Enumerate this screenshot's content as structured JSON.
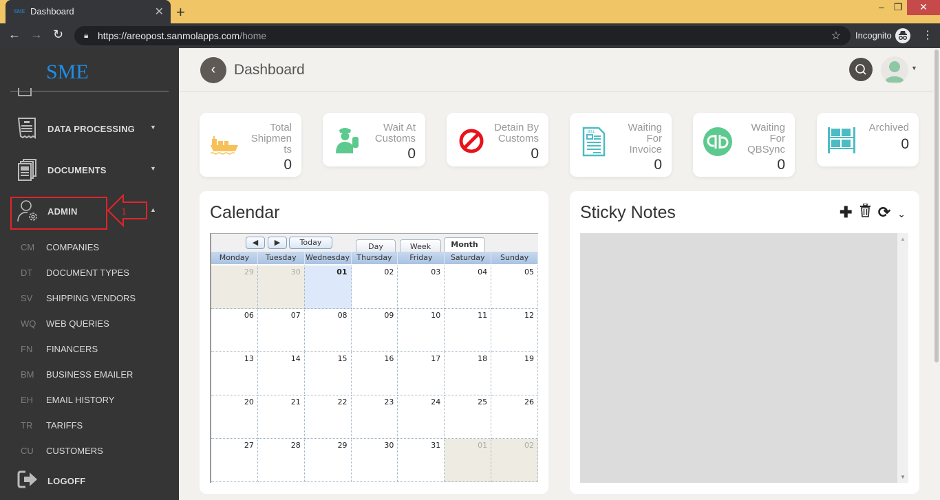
{
  "browser": {
    "tab_title": "Dashboard",
    "tab_favicon_text": "SME",
    "url_host": "https://areopost.sanmolapps.com",
    "url_path": "/home",
    "incognito_label": "Incognito"
  },
  "sidebar": {
    "logo": "SME",
    "items": [
      {
        "label": "DATA PROCESSING",
        "icon": "receipt-icon",
        "expanded": false
      },
      {
        "label": "DOCUMENTS",
        "icon": "documents-icon",
        "expanded": false
      },
      {
        "label": "ADMIN",
        "icon": "user-gear-icon",
        "expanded": true
      }
    ],
    "annotation_number": "1",
    "admin_subitems": [
      {
        "abbr": "CM",
        "label": "COMPANIES"
      },
      {
        "abbr": "DT",
        "label": "DOCUMENT TYPES"
      },
      {
        "abbr": "SV",
        "label": "SHIPPING VENDORS"
      },
      {
        "abbr": "WQ",
        "label": "WEB QUERIES"
      },
      {
        "abbr": "FN",
        "label": "FINANCERS"
      },
      {
        "abbr": "BM",
        "label": "BUSINESS EMAILER"
      },
      {
        "abbr": "EH",
        "label": "EMAIL HISTORY"
      },
      {
        "abbr": "TR",
        "label": "TARIFFS"
      },
      {
        "abbr": "CU",
        "label": "CUSTOMERS"
      }
    ],
    "logoff": "LOGOFF"
  },
  "header": {
    "title": "Dashboard"
  },
  "stats": [
    {
      "label_lines": [
        "Total",
        "Shipmen",
        "ts"
      ],
      "value": "0",
      "icon": "ship-icon",
      "color": "#f7c15a"
    },
    {
      "label_lines": [
        "Wait At",
        "Customs"
      ],
      "value": "0",
      "icon": "customs-officer-icon",
      "color": "#5cc98f"
    },
    {
      "label_lines": [
        "Detain By",
        "Customs"
      ],
      "value": "0",
      "icon": "prohibited-icon",
      "color": "#e8121a"
    },
    {
      "label_lines": [
        "Waiting",
        "For",
        "Invoice"
      ],
      "value": "0",
      "icon": "bill-icon",
      "color": "#4bbcc4"
    },
    {
      "label_lines": [
        "Waiting",
        "For",
        "QBSync"
      ],
      "value": "0",
      "icon": "quickbooks-icon",
      "color": "#5cc98f"
    },
    {
      "label_lines": [
        "Archived"
      ],
      "value": "0",
      "icon": "archive-shelf-icon",
      "color": "#4bbcc4"
    }
  ],
  "calendar": {
    "title": "Calendar",
    "today_label": "Today",
    "views": [
      "Day",
      "Week",
      "Month"
    ],
    "active_view": "Month",
    "weekdays": [
      "Monday",
      "Tuesday",
      "Wednesday",
      "Thursday",
      "Friday",
      "Saturday",
      "Sunday"
    ],
    "days": [
      {
        "d": "29",
        "t": "other"
      },
      {
        "d": "30",
        "t": "other"
      },
      {
        "d": "01",
        "t": "today"
      },
      {
        "d": "02"
      },
      {
        "d": "03"
      },
      {
        "d": "04"
      },
      {
        "d": "05"
      },
      {
        "d": "06"
      },
      {
        "d": "07"
      },
      {
        "d": "08"
      },
      {
        "d": "09"
      },
      {
        "d": "10"
      },
      {
        "d": "11"
      },
      {
        "d": "12"
      },
      {
        "d": "13"
      },
      {
        "d": "14"
      },
      {
        "d": "15"
      },
      {
        "d": "16"
      },
      {
        "d": "17"
      },
      {
        "d": "18"
      },
      {
        "d": "19"
      },
      {
        "d": "20"
      },
      {
        "d": "21"
      },
      {
        "d": "22"
      },
      {
        "d": "23"
      },
      {
        "d": "24"
      },
      {
        "d": "25"
      },
      {
        "d": "26"
      },
      {
        "d": "27"
      },
      {
        "d": "28"
      },
      {
        "d": "29"
      },
      {
        "d": "30"
      },
      {
        "d": "31"
      },
      {
        "d": "01",
        "t": "other"
      },
      {
        "d": "02",
        "t": "other"
      }
    ]
  },
  "sticky_notes": {
    "title": "Sticky Notes"
  }
}
